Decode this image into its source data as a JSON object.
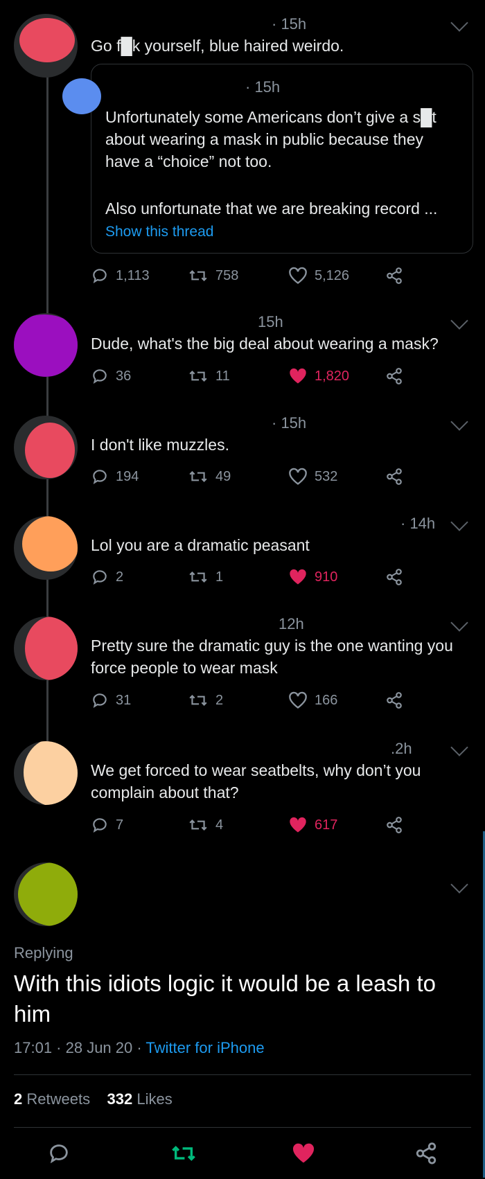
{
  "tweets": [
    {
      "time": "· 15h",
      "text": "Go f█k yourself, blue haired weirdo.",
      "quote": {
        "time": "· 15h",
        "text": "Unfortunately some Americans don’t give a s█t about wearing a mask in public because they have a “choice” not too.",
        "text2": "Also unfortunate that we are breaking record ...",
        "show_thread": "Show this thread"
      },
      "replies": "1,113",
      "retweets": "758",
      "likes": "5,126",
      "liked": false
    },
    {
      "time": "15h",
      "text": "Dude, what's the big deal about wearing a mask?",
      "replies": "36",
      "retweets": "11",
      "likes": "1,820",
      "liked": true
    },
    {
      "time": "· 15h",
      "text": "I don't like muzzles.",
      "replies": "194",
      "retweets": "49",
      "likes": "532",
      "liked": false
    },
    {
      "time": "· 14h",
      "text": "Lol you are a dramatic peasant",
      "replies": "2",
      "retweets": "1",
      "likes": "910",
      "liked": true
    },
    {
      "time": "12h",
      "text": "Pretty sure the dramatic guy is the one wanting you force people to wear mask",
      "replies": "31",
      "retweets": "2",
      "likes": "166",
      "liked": false
    },
    {
      "time": ".2h",
      "text": "We get forced to wear seatbelts, why don’t you complain about that?",
      "replies": "7",
      "retweets": "4",
      "likes": "617",
      "liked": true
    }
  ],
  "main_tweet": {
    "replying": "Replying",
    "text": "With this idiots logic it would be a leash to him",
    "time": "17:01 · 28 Jun 20 · ",
    "client": "Twitter for iPhone",
    "retweets_count": "2",
    "retweets_label": "Retweets",
    "likes_count": "332",
    "likes_label": "Likes"
  },
  "colors": {
    "accent": "#1d9bf0",
    "like": "#e0245e",
    "retweet_active": "#00ba7c",
    "avatar_blobs": [
      "#e84a5f",
      "#9b0fbf",
      "#e84a5f",
      "#ff9f5a",
      "#e84a5f",
      "#fcd0a1",
      "#8fac0b"
    ],
    "quote_avatar_blob": "#5b8def"
  },
  "icons": [
    "reply-icon",
    "retweet-icon",
    "like-icon",
    "share-icon",
    "chevron-down-icon"
  ]
}
